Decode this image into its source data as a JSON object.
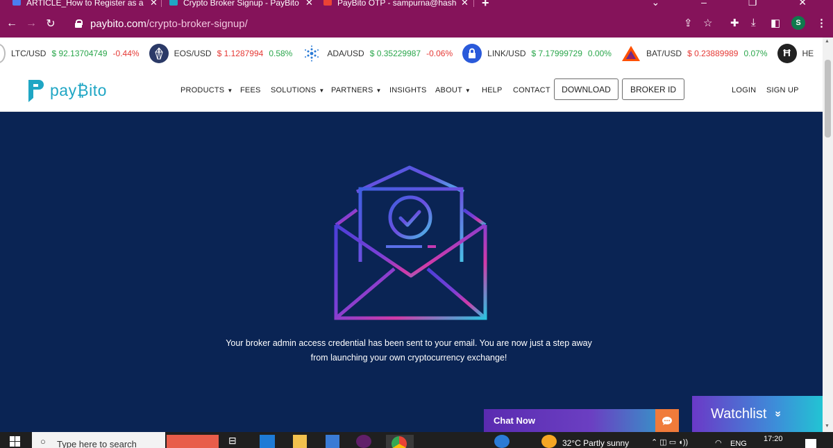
{
  "browser": {
    "tabs": [
      {
        "label": "ARTICLE_How to Register as a br",
        "close": "✕",
        "active": false,
        "favicon_color": "#4a7df0"
      },
      {
        "label": "Crypto Broker Signup - PayBito",
        "close": "✕",
        "active": true,
        "favicon_color": "#1fa6c4"
      },
      {
        "label": "PayBito OTP - sampurna@hashcas",
        "close": "✕",
        "active": false,
        "favicon_color": "#ea4335"
      }
    ],
    "new_tab": "+",
    "url_host": "paybito.com",
    "url_path": "/crypto-broker-signup/",
    "profile_initial": "S"
  },
  "ticker": [
    {
      "pair": "LTC/USD",
      "price": "$ 92.13704749",
      "change": "-0.44%",
      "direction": "down",
      "logo": "ltc-icon",
      "logo_color": "#ffffff"
    },
    {
      "pair": "EOS/USD",
      "price": "$ 1.1287994",
      "change": "0.58%",
      "direction": "down_up",
      "logo": "eos-icon",
      "logo_color": "#2b3a67"
    },
    {
      "pair": "ADA/USD",
      "price": "$ 0.35229987",
      "change": "-0.06%",
      "direction": "up_down",
      "logo": "ada-icon",
      "logo_color": "#ffffff"
    },
    {
      "pair": "LINK/USD",
      "price": "$ 7.17999729",
      "change": "0.00%",
      "direction": "up",
      "logo": "link-icon",
      "logo_color": "#2a5ada"
    },
    {
      "pair": "BAT/USD",
      "price": "$ 0.23889989",
      "change": "0.07%",
      "direction": "down_up",
      "logo": "bat-icon",
      "logo_color": "#ffffff"
    },
    {
      "pair": "HE",
      "price": "",
      "change": "",
      "direction": "none",
      "logo": "hbar-icon",
      "logo_color": "#222222"
    }
  ],
  "header": {
    "logo_text": "pay₿ito",
    "nav": [
      {
        "label": "PRODUCTS",
        "caret": true
      },
      {
        "label": "FEES",
        "caret": false
      },
      {
        "label": "SOLUTIONS",
        "caret": true
      },
      {
        "label": "PARTNERS",
        "caret": true
      },
      {
        "label": "INSIGHTS",
        "caret": false
      },
      {
        "label": "ABOUT",
        "caret": true
      },
      {
        "label": "HELP",
        "caret": false
      },
      {
        "label": "CONTACT",
        "caret": false
      }
    ],
    "download_label": "DOWNLOAD",
    "broker_id_label": "BROKER ID",
    "login_label": "LOGIN",
    "signup_label": "SIGN UP"
  },
  "hero": {
    "message_line1": "Your broker admin access credential has been sent to your email. You are now just a step away",
    "message_line2": "from launching your own cryptocurrency exchange!"
  },
  "widgets": {
    "chat_label": "Chat Now",
    "watchlist_label": "Watchlist",
    "watchlist_chevron": "»"
  },
  "taskbar": {
    "search_placeholder": "Type here to search",
    "weather": "32°C  Partly sunny",
    "lang": "ENG",
    "time": "17:20"
  }
}
